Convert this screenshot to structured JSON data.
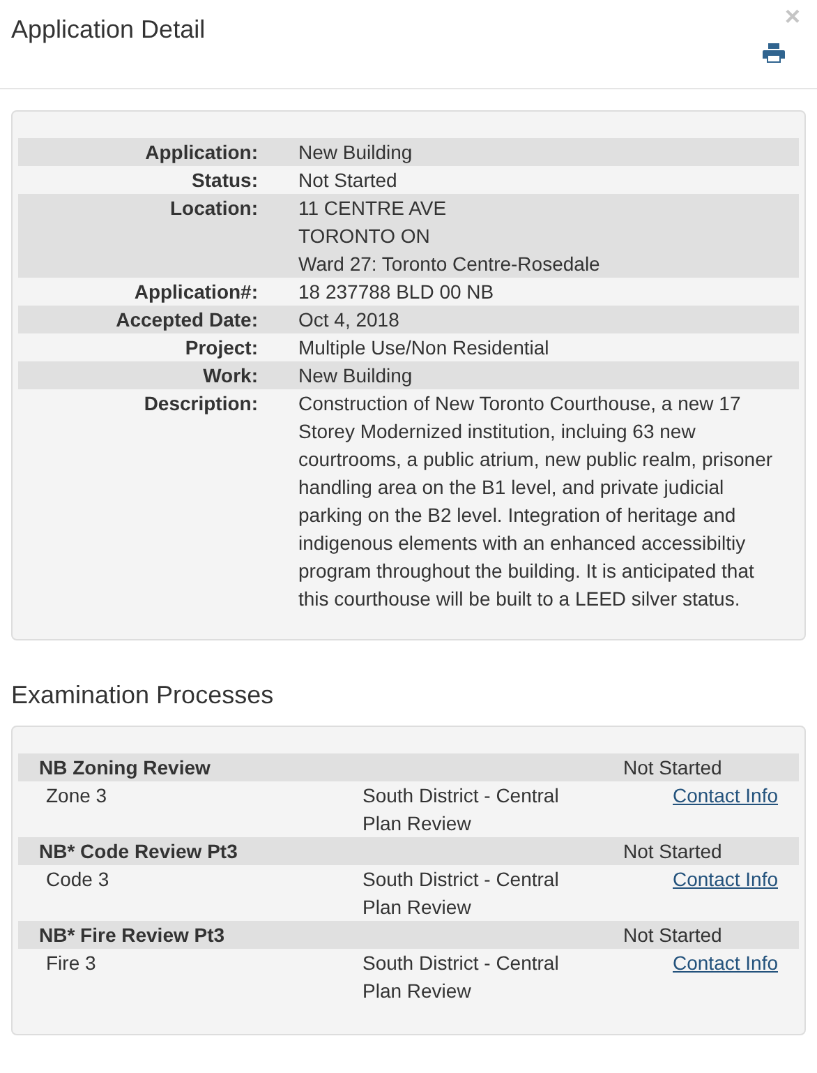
{
  "window": {
    "title": "Application Detail",
    "close": "×"
  },
  "details": [
    {
      "label": "Application:",
      "lines": [
        "New Building"
      ]
    },
    {
      "label": "Status:",
      "lines": [
        "Not Started"
      ]
    },
    {
      "label": "Location:",
      "lines": [
        "11 CENTRE AVE",
        "TORONTO ON",
        "Ward 27: Toronto Centre-Rosedale"
      ]
    },
    {
      "label": "Application#:",
      "lines": [
        "18 237788 BLD 00 NB"
      ]
    },
    {
      "label": "Accepted Date:",
      "lines": [
        "Oct 4, 2018"
      ]
    },
    {
      "label": "Project:",
      "lines": [
        "Multiple Use/Non Residential"
      ]
    },
    {
      "label": "Work:",
      "lines": [
        "New Building"
      ]
    },
    {
      "label": "Description:",
      "lines": [
        "Construction of New Toronto Courthouse, a new 17 Storey Modernized institution, incluing 63 new courtrooms, a public atrium, new public realm, prisoner handling area on the B1 level, and private judicial parking on the B2 level. Integration of heritage and indigenous elements with an enhanced accessibiltiy program throughout the building. It is anticipated that this courthouse will be built to a LEED silver status."
      ]
    }
  ],
  "examination": {
    "title": "Examination Processes",
    "processes": [
      {
        "name": "NB Zoning Review",
        "status": "Not Started",
        "unit": "Zone 3",
        "district": "South District - Central Plan Review",
        "link": "Contact Info"
      },
      {
        "name": "NB* Code Review Pt3",
        "status": "Not Started",
        "unit": "Code 3",
        "district": "South District - Central Plan Review",
        "link": "Contact Info"
      },
      {
        "name": "NB* Fire Review Pt3",
        "status": "Not Started",
        "unit": "Fire 3",
        "district": "South District - Central Plan Review",
        "link": "Contact Info"
      }
    ]
  }
}
